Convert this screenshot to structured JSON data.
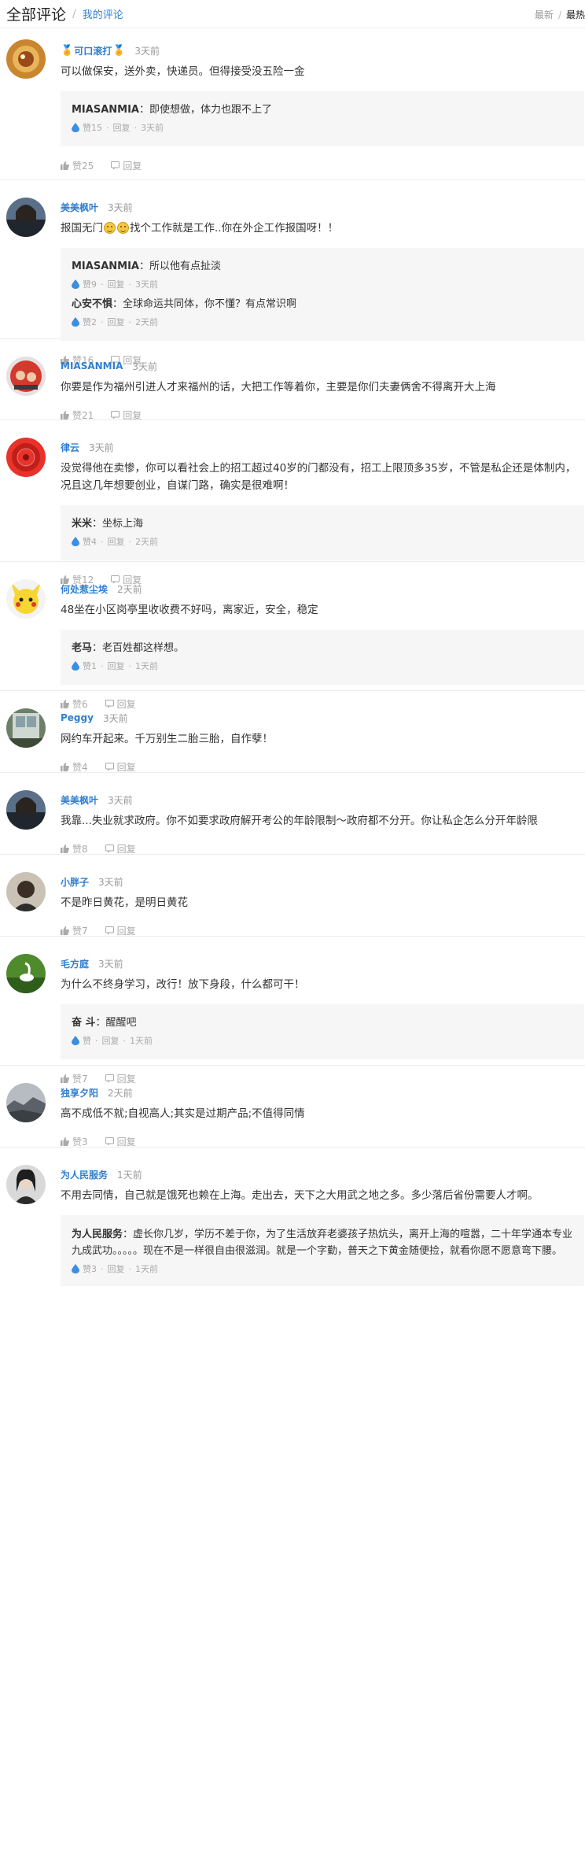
{
  "header": {
    "title": "全部评论",
    "separator": "/",
    "mine_link": "我的评论",
    "sort_latest": "最新",
    "sort_sep": "/",
    "sort_hot": "最热"
  },
  "labels": {
    "reply": "回复"
  },
  "colors": {
    "accent": "#2f7fd0",
    "reply_bg": "#f6f6f6",
    "divider": "#ededed"
  },
  "comments": [
    {
      "user": "可口滚打",
      "time": "3天前",
      "text": "可以做保安，送外卖，快递员。但得接受没五险一金",
      "likes": "赞25",
      "replies": [
        {
          "name": "MIASANMIA",
          "text": "：即使想做，体力也跟不上了",
          "likes": "赞15",
          "reply": "回复",
          "time": "3天前"
        }
      ]
    },
    {
      "user": "美美枫叶",
      "time": "3天前",
      "text_pre": "报国无门",
      "text_post": "找个工作就是工作..你在外企工作报国呀！！",
      "likes": "赞16",
      "replies": [
        {
          "name": "MIASANMIA",
          "text": "：所以他有点扯淡",
          "likes": "赞9",
          "reply": "回复",
          "time": "3天前"
        },
        {
          "name": "心安不惧",
          "text": "：全球命运共同体，你不懂？有点常识啊",
          "likes": "赞2",
          "reply": "回复",
          "time": "2天前"
        }
      ]
    },
    {
      "user": "MIASANMIA",
      "time": "3天前",
      "text": "你要是作为福州引进人才来福州的话，大把工作等着你，主要是你们夫妻俩舍不得离开大上海",
      "likes": "赞21",
      "replies": []
    },
    {
      "user": "律云",
      "time": "3天前",
      "text": "没觉得他在卖惨，你可以看社会上的招工超过40岁的门都没有，招工上限顶多35岁，不管是私企还是体制内，况且这几年想要创业，自谋门路，确实是很难啊！",
      "likes": "赞12",
      "replies": [
        {
          "name": "米米",
          "text": "：坐标上海",
          "likes": "赞4",
          "reply": "回复",
          "time": "2天前"
        }
      ]
    },
    {
      "user": "何处惹尘埃",
      "time": "2天前",
      "text": "48坐在小区岗亭里收收费不好吗，离家近，安全，稳定",
      "likes": "赞6",
      "replies": [
        {
          "name": "老马",
          "text": "：老百姓都这样想。",
          "likes": "赞1",
          "reply": "回复",
          "time": "1天前"
        }
      ]
    },
    {
      "user": "Peggy",
      "time": "3天前",
      "text": "网约车开起来。千万别生二胎三胎，自作孽！",
      "likes": "赞4",
      "replies": []
    },
    {
      "user": "美美枫叶",
      "time": "3天前",
      "text": "我靠...失业就求政府。你不如要求政府解开考公的年龄限制～政府都不分开。你让私企怎么分开年龄限",
      "likes": "赞8",
      "replies": []
    },
    {
      "user": "小胖子",
      "time": "3天前",
      "text": "不是昨日黄花，是明日黄花",
      "likes": "赞7",
      "replies": []
    },
    {
      "user": "毛方庭",
      "time": "3天前",
      "text": "为什么不终身学习，改行！放下身段，什么都可干！",
      "likes": "赞7",
      "replies": [
        {
          "name": "奋 斗",
          "text": "：醒醒吧",
          "likes": "赞",
          "reply": "回复",
          "time": "1天前"
        }
      ]
    },
    {
      "user": "独享夕阳",
      "time": "2天前",
      "text": "高不成低不就;自视高人;其实是过期产品;不值得同情",
      "likes": "赞3",
      "replies": []
    },
    {
      "user": "为人民服务",
      "time": "1天前",
      "text": "不用去同情，自己就是饿死也赖在上海。走出去，天下之大用武之地之多。多少落后省份需要人才啊。",
      "likes": "",
      "replies": [
        {
          "name": "为人民服务",
          "text": "：虚长你几岁，学历不差于你，为了生活放弃老婆孩子热炕头，离开上海的喧嚣，二十年学通本专业九成武功。。。。。现在不是一样很自由很滋润。就是一个字勤，普天之下黄金随便捡，就看你愿不愿意弯下腰。",
          "likes": "赞3",
          "reply": "回复",
          "time": "1天前"
        }
      ]
    }
  ]
}
